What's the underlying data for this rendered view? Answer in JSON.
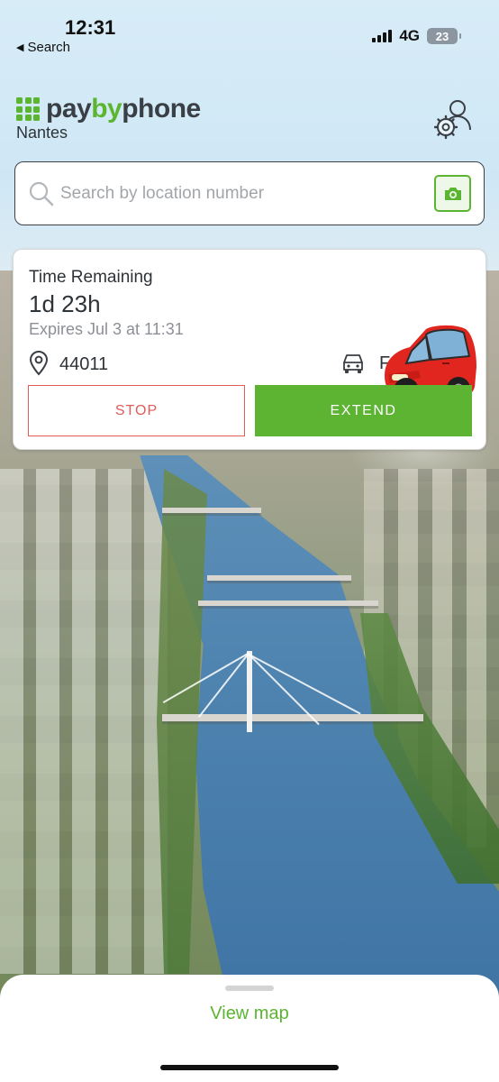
{
  "status_bar": {
    "time": "12:31",
    "back_label": "Search",
    "network": "4G",
    "battery": "23"
  },
  "header": {
    "brand_pay": "pay",
    "brand_by": "by",
    "brand_phone": "phone",
    "city": "Nantes"
  },
  "search": {
    "placeholder": "Search by location number"
  },
  "session": {
    "label": "Time Remaining",
    "duration": "1d 23h",
    "expiry": "Expires Jul 3 at 11:31",
    "location_number": "44011",
    "plate_partial": "F",
    "stop_label": "STOP",
    "extend_label": "EXTEND"
  },
  "bottom_sheet": {
    "view_map_label": "View map"
  },
  "colors": {
    "brand_green": "#5cb531",
    "stop_red": "#e15b5b",
    "text_dark": "#2e3338",
    "text_muted": "#8c9096"
  },
  "icons": [
    "back-arrow-icon",
    "signal-icon",
    "battery-icon",
    "brand-grid-icon",
    "account-settings-icon",
    "search-icon",
    "camera-icon",
    "location-pin-icon",
    "vehicle-icon",
    "car-sticker-icon"
  ]
}
